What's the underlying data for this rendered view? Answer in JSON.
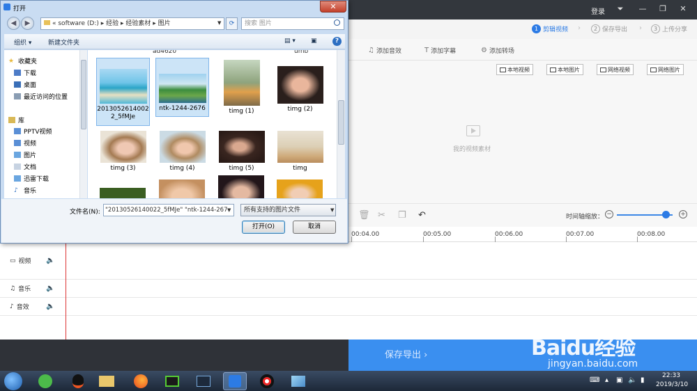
{
  "app": {
    "login": "登录",
    "window_controls": [
      "⏷",
      "—",
      "❐",
      "✕"
    ],
    "steps": [
      {
        "num": "1",
        "label": "剪辑视频"
      },
      {
        "num": "2",
        "label": "保存导出"
      },
      {
        "num": "3",
        "label": "上传分享"
      }
    ],
    "toolbar": {
      "add_audio": "添加音效",
      "add_subtitle": "添加字幕",
      "add_transition": "添加转场"
    },
    "sources": [
      "本地视频",
      "本地图片",
      "网络视频",
      "网络图片"
    ],
    "material_empty": "我的视频素材",
    "zoom_label": "时间轴缩放：",
    "ruler_ticks": [
      "00:04.00",
      "00:05.00",
      "00:06.00",
      "00:07.00",
      "00:08.00"
    ],
    "tracks": {
      "video": "视频",
      "music": "音乐",
      "effect": "音效"
    },
    "export_button": "保存导出",
    "accent_color": "#3a8ff0"
  },
  "watermark": {
    "logo": "Baidu经验",
    "url": "jingyan.baidu.com"
  },
  "taskbar": {
    "time": "22:33",
    "date": "2019/3/10"
  },
  "dialog": {
    "title": "打开",
    "close": "✕",
    "address": "« software (D:) ▸ 经验 ▸ 经验素材 ▸ 图片",
    "search_placeholder": "搜索 图片",
    "organize": "组织 ▾",
    "new_folder": "新建文件夹",
    "help": "?",
    "nav": {
      "favorites": "收藏夹",
      "downloads": "下载",
      "desktop": "桌面",
      "recent": "最近访问的位置",
      "libraries": "库",
      "pptv": "PPTV视频",
      "videos": "视频",
      "pictures": "图片",
      "documents": "文档",
      "xunlei": "迅雷下载",
      "music": "音乐"
    },
    "partial_names": [
      "ad4620",
      "umb"
    ],
    "files": [
      {
        "name": "20130526140022_5fMJe"
      },
      {
        "name": "ntk-1244-2676"
      },
      {
        "name": "timg (1)"
      },
      {
        "name": "timg (2)"
      },
      {
        "name": "timg (3)"
      },
      {
        "name": "timg (4)"
      },
      {
        "name": "timg (5)"
      },
      {
        "name": "timg"
      }
    ],
    "filename_label": "文件名(N):",
    "filename_value": "\"20130526140022_5fMJe\" \"ntk-1244-267",
    "filter": "所有支持的图片文件",
    "open": "打开(O)",
    "cancel": "取消"
  }
}
